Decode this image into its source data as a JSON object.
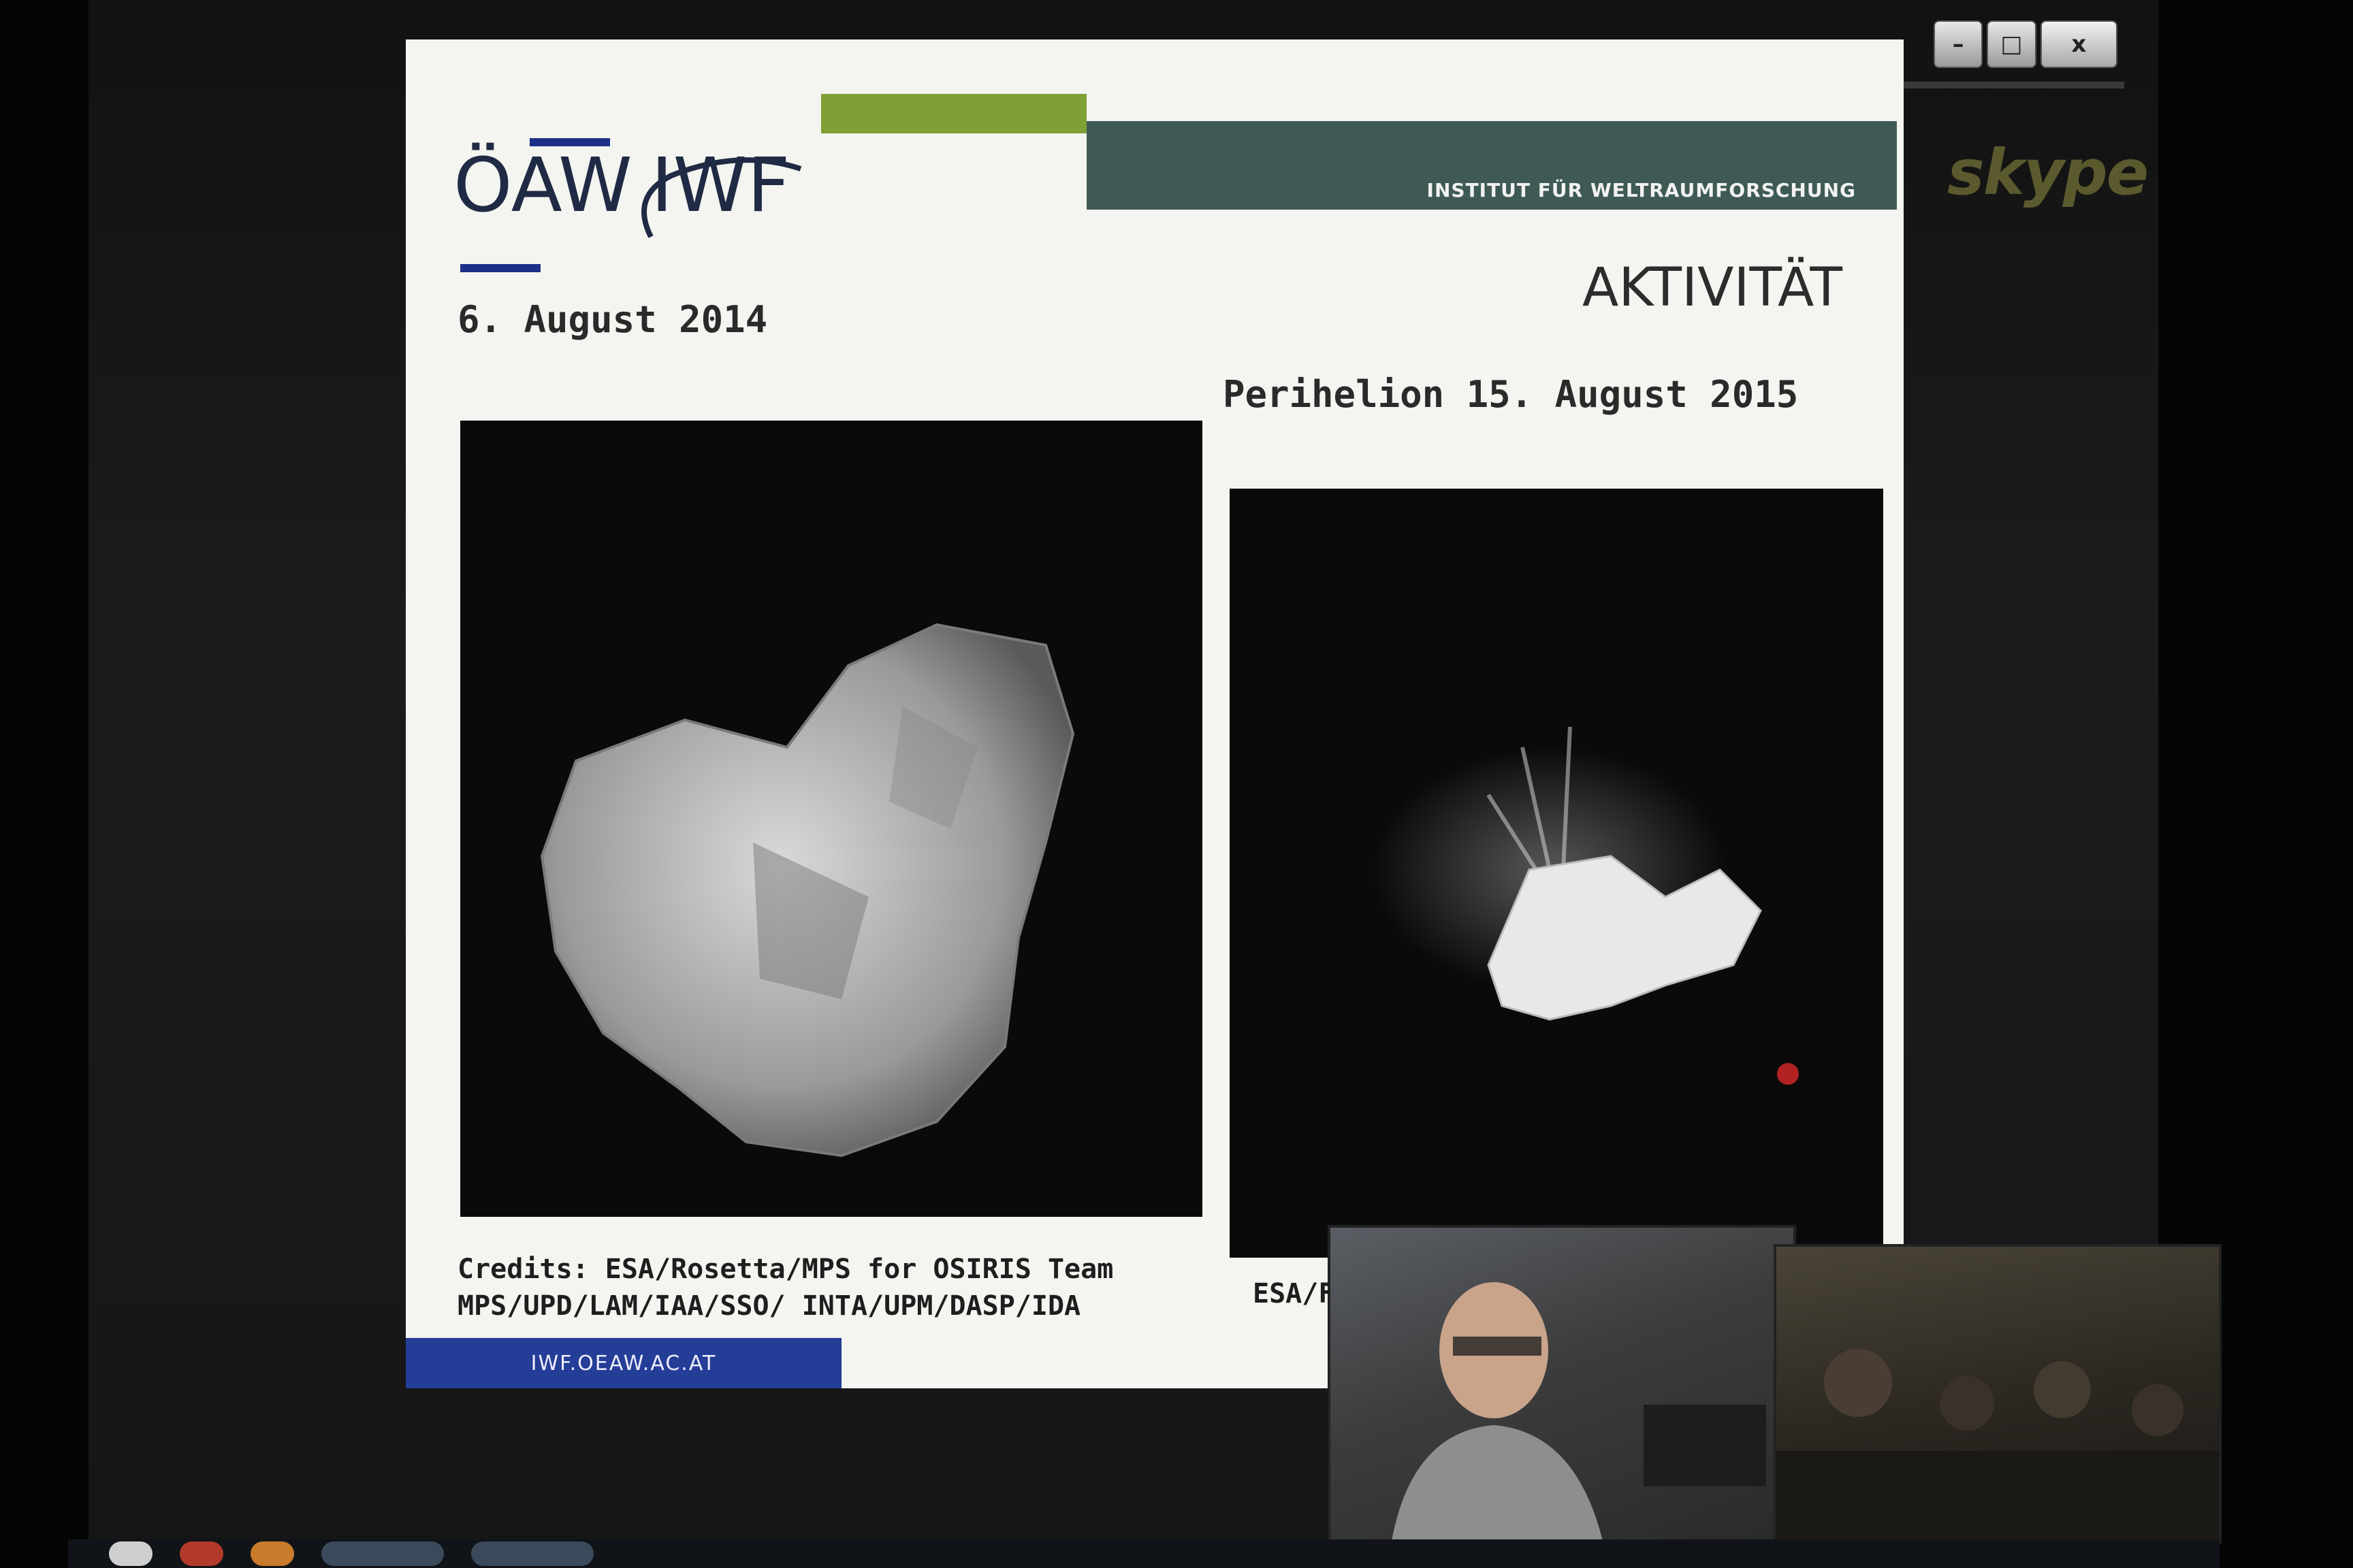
{
  "window": {
    "controls": {
      "minimize": "–",
      "restore": "□",
      "close": "x"
    },
    "app_logo_text": "skype"
  },
  "slide": {
    "logo": {
      "left": "ÖAW",
      "right": "IWF"
    },
    "institute_banner": "INSTITUT FÜR WELTRAUMFORSCHUNG",
    "title": "AKTIVITÄT",
    "left_caption": "6. August 2014",
    "right_caption": "Perihelion 15. August 2015",
    "credits": [
      "Credits: ESA/Rosetta/MPS for OSIRIS Team",
      "MPS/UPD/LAM/IAA/SSO/ INTA/UPM/DASP/IDA"
    ],
    "right_credit_partial": "ESA/F",
    "footer_url": "IWF.OEAW.AC.AT"
  },
  "colors": {
    "green_bar": "#7fa035",
    "dark_banner": "#3f5a55",
    "footer_blue": "#243d97",
    "logo_navy": "#1f2a44"
  }
}
